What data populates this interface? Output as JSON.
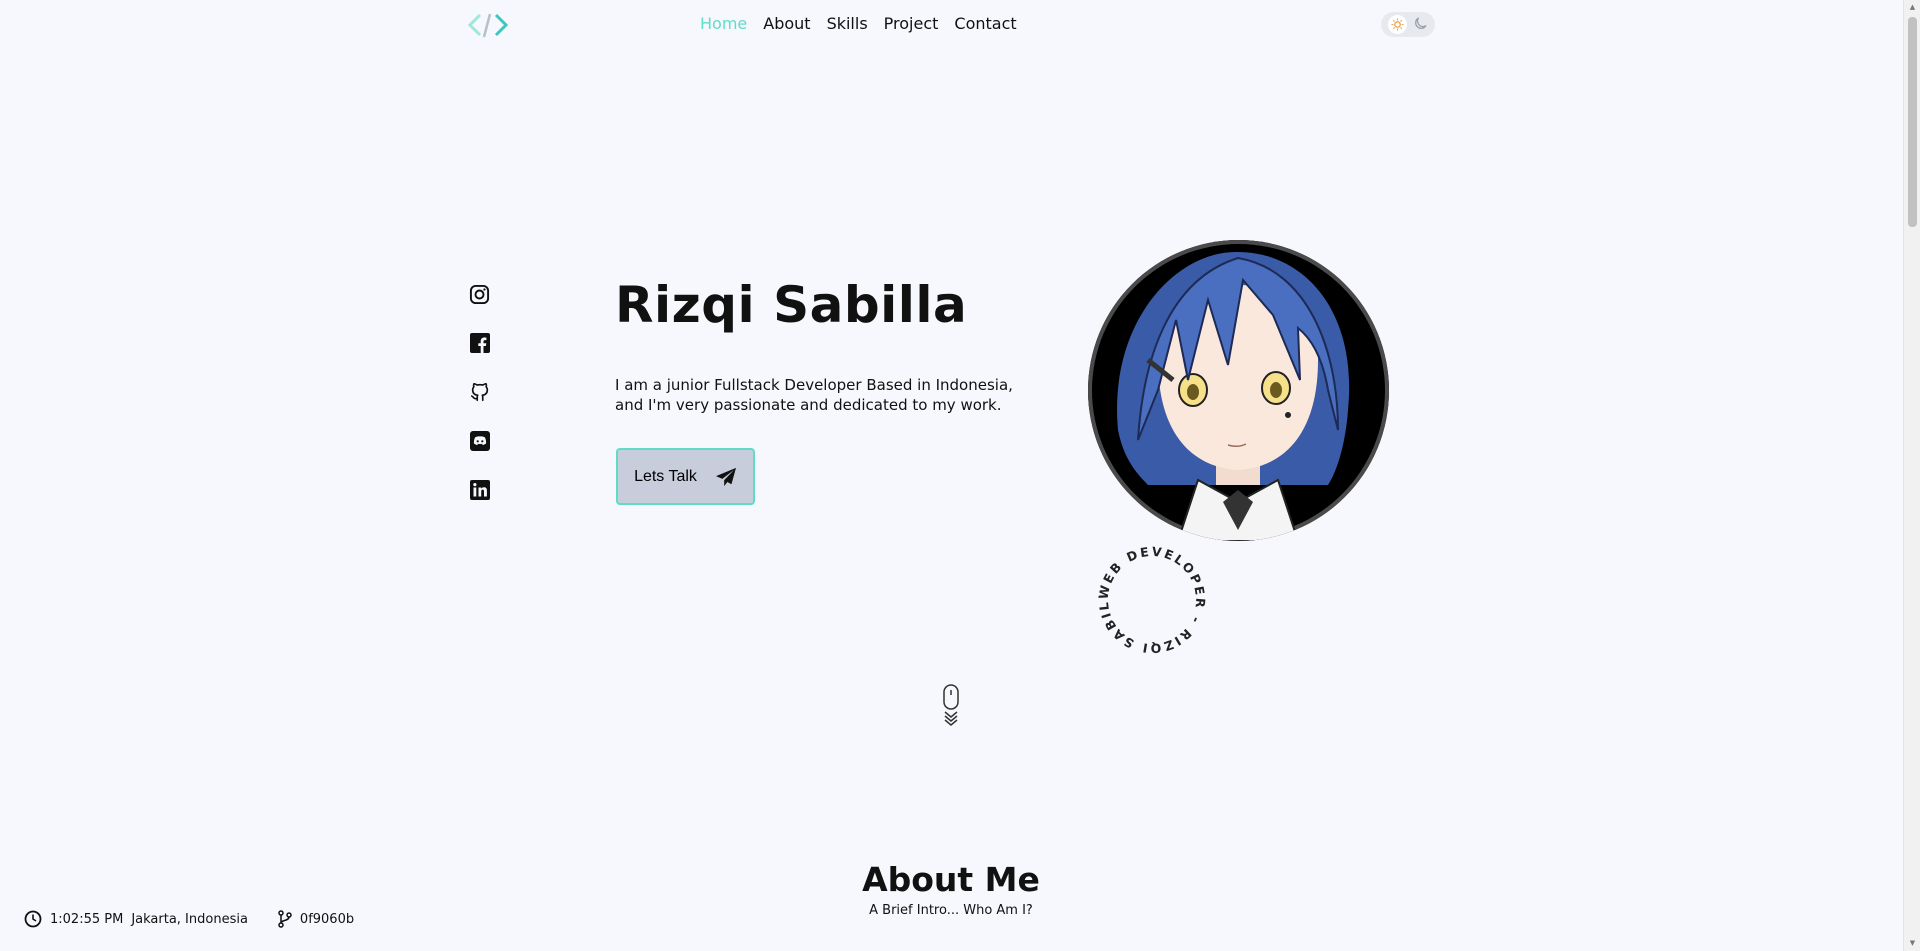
{
  "header": {
    "logo_icon": "code-brackets-icon",
    "nav": [
      {
        "label": "Home",
        "active": true
      },
      {
        "label": "About",
        "active": false
      },
      {
        "label": "Skills",
        "active": false
      },
      {
        "label": "Project",
        "active": false
      },
      {
        "label": "Contact",
        "active": false
      }
    ],
    "theme_toggle": {
      "light_icon": "sun-icon",
      "dark_icon": "moon-icon"
    }
  },
  "socials": [
    "instagram-icon",
    "facebook-icon",
    "github-icon",
    "discord-icon",
    "linkedin-icon"
  ],
  "hero": {
    "name": "Rizqi Sabilla",
    "description_line1": "I am a junior Fullstack Developer Based in Indonesia,",
    "description_line2": "and I'm very passionate and dedicated to my work.",
    "cta_label": "Lets Talk",
    "cta_icon": "paper-plane-icon",
    "badge_text": "WEB DEVELOPER - RIZQI SABILLA - "
  },
  "about": {
    "title": "About Me",
    "subtitle": "A Brief Intro... Who Am I?"
  },
  "status": {
    "time": "1:02:55 PM",
    "location": "Jakarta, Indonesia",
    "commit": "0f9060b"
  },
  "colors": {
    "accent": "#5fdcc7",
    "background": "#f6f8fd",
    "button_bg": "#c7cddb"
  }
}
